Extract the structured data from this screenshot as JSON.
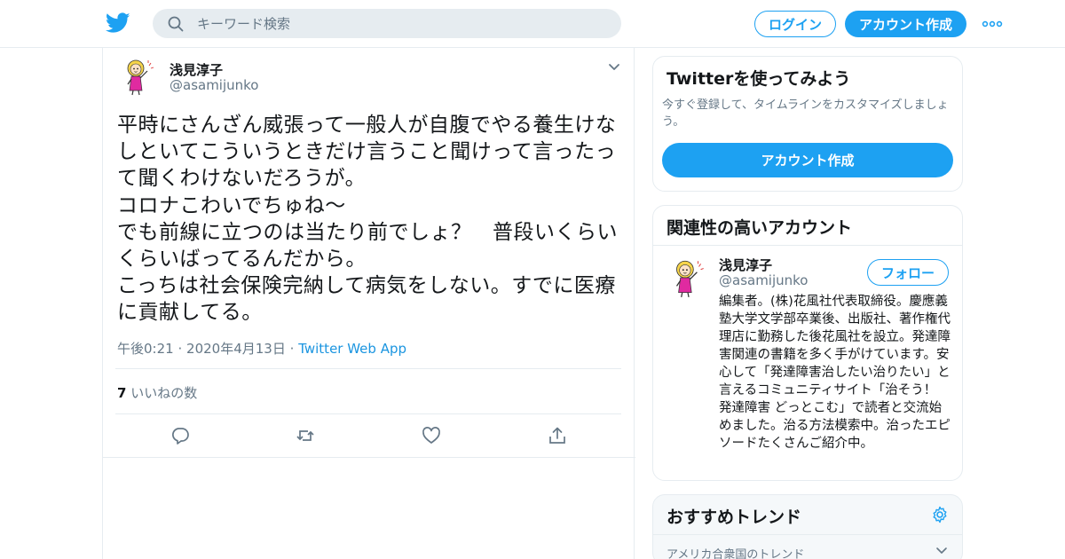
{
  "header": {
    "logo_icon": "twitter-bird-icon",
    "search_placeholder": "キーワード検索",
    "login_label": "ログイン",
    "signup_label": "アカウント作成",
    "more_icon": "more-dots-icon",
    "brand_color": "#1da1f2"
  },
  "tweet": {
    "author_name": "浅見淳子",
    "author_handle": "@asamijunko",
    "text": "平時にさんざん威張って一般人が自腹でやる養生けなしといてこういうときだけ言うこと聞けって言ったって聞くわけないだろうが。\nコロナこわいでちゅね～\nでも前線に立つのは当たり前でしょ？　普段いくらいくらいばってるんだから。\nこっちは社会保険完納して病気をしない。すでに医療に貢献してる。",
    "time": "午後0:21",
    "sep": "·",
    "date": "2020年4月13日",
    "source": "Twitter Web App",
    "likes_count": "7",
    "likes_label": "いいねの数",
    "action_icons": [
      "reply-icon",
      "retweet-icon",
      "like-icon",
      "share-icon"
    ]
  },
  "signup_card": {
    "title": "Twitterを使ってみよう",
    "description": "今すぐ登録して、タイムラインをカスタマイズしましょう。",
    "button_label": "アカウント作成"
  },
  "related_card": {
    "title": "関連性の高いアカウント",
    "account_name": "浅見淳子",
    "account_handle": "@asamijunko",
    "follow_label": "フォロー",
    "bio": "編集者。(株)花風社代表取締役。慶應義塾大学文学部卒業後、出版社、著作権代理店に勤務した後花風社を設立。発達障害関連の書籍を多く手がけています。安心して「発達障害治したい治りたい」と言えるコミュニティサイト「治そう！ 発達障害 どっとこむ」で読者と交流始めました。治る方法模索中。治ったエピソードたくさんご紹介中。"
  },
  "trends_card": {
    "title": "おすすめトレンド",
    "subtitle": "アメリカ合衆国のトレンド"
  }
}
